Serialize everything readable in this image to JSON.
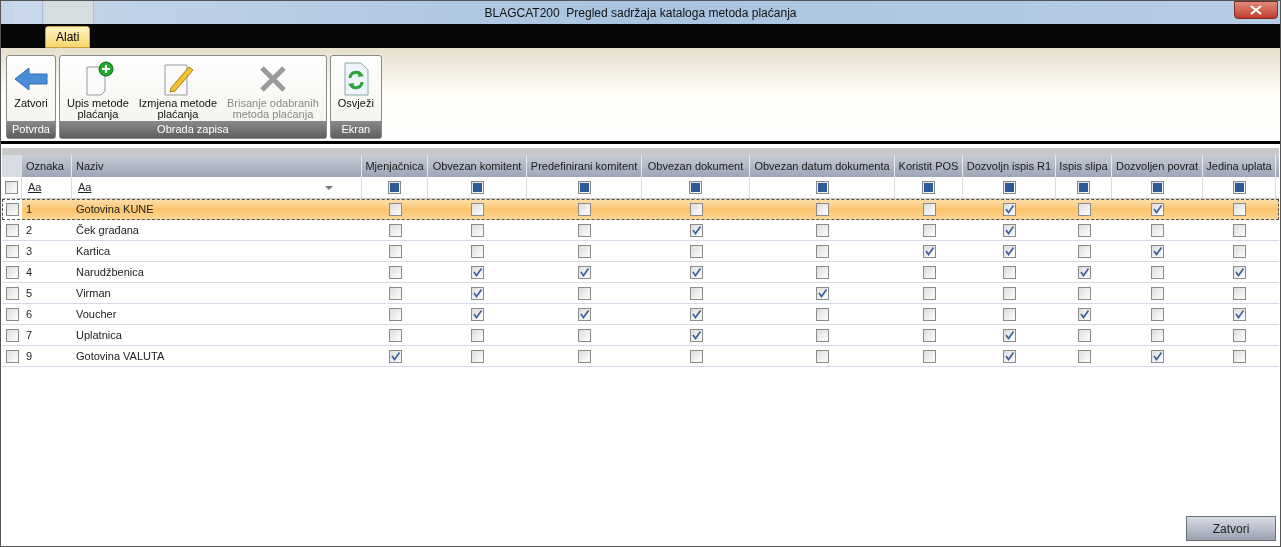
{
  "window": {
    "title": "BLAGCAT200  Pregled sadržaja kataloga metoda plaćanja"
  },
  "tabs": [
    {
      "label": "Alati",
      "selected": true
    }
  ],
  "ribbon": {
    "groups": [
      {
        "label": "Potvrda",
        "buttons": [
          {
            "kind": "back",
            "label": "Zatvori",
            "disabled": false
          }
        ]
      },
      {
        "label": "Obrada zapisa",
        "buttons": [
          {
            "kind": "add",
            "label": "Upis metode\nplaćanja",
            "disabled": false
          },
          {
            "kind": "edit",
            "label": "Izmjena metode\nplaćanja",
            "disabled": false
          },
          {
            "kind": "delete",
            "label": "Brisanje odabranih\nmetoda plaćanja",
            "disabled": true
          }
        ]
      },
      {
        "label": "Ekran",
        "buttons": [
          {
            "kind": "refresh",
            "label": "Osvježi",
            "disabled": false
          }
        ]
      }
    ]
  },
  "table": {
    "columns": [
      {
        "label": "Oznaka",
        "filter": "Aa"
      },
      {
        "label": "Naziv",
        "filter": "Aa"
      },
      {
        "label": "Mjenjačnica",
        "filter_indeterminate": true
      },
      {
        "label": "Obvezan komitent",
        "filter_indeterminate": true
      },
      {
        "label": "Predefinirani komitent",
        "filter_indeterminate": true
      },
      {
        "label": "Obvezan dokument",
        "filter_indeterminate": true
      },
      {
        "label": "Obvezan datum dokumenta",
        "filter_indeterminate": true
      },
      {
        "label": "Koristit POS",
        "filter_indeterminate": true
      },
      {
        "label": "Dozvoljn ispis R1",
        "filter_indeterminate": true
      },
      {
        "label": "Ispis slipa",
        "filter_indeterminate": true
      },
      {
        "label": "Dozvoljen povrat",
        "filter_indeterminate": true
      },
      {
        "label": "Jedina uplata",
        "filter_indeterminate": true
      }
    ],
    "select_all_checked": false,
    "rows": [
      {
        "oznaka": "1",
        "naziv": "Gotovina KUNE",
        "selected": true,
        "checked": false,
        "flags": [
          false,
          false,
          false,
          false,
          false,
          false,
          true,
          false,
          true,
          false
        ]
      },
      {
        "oznaka": "2",
        "naziv": "Ček građana",
        "selected": false,
        "checked": false,
        "flags": [
          false,
          false,
          false,
          true,
          false,
          false,
          true,
          false,
          false,
          false
        ]
      },
      {
        "oznaka": "3",
        "naziv": "Kartica",
        "selected": false,
        "checked": false,
        "flags": [
          false,
          false,
          false,
          false,
          false,
          true,
          true,
          false,
          true,
          false
        ]
      },
      {
        "oznaka": "4",
        "naziv": "Narudžbenica",
        "selected": false,
        "checked": false,
        "flags": [
          false,
          true,
          true,
          true,
          false,
          false,
          false,
          true,
          false,
          true
        ]
      },
      {
        "oznaka": "5",
        "naziv": "Virman",
        "selected": false,
        "checked": false,
        "flags": [
          false,
          true,
          false,
          false,
          true,
          false,
          false,
          false,
          false,
          false
        ]
      },
      {
        "oznaka": "6",
        "naziv": "Voucher",
        "selected": false,
        "checked": false,
        "flags": [
          false,
          true,
          true,
          true,
          false,
          false,
          false,
          true,
          false,
          true
        ]
      },
      {
        "oznaka": "7",
        "naziv": "Uplatnica",
        "selected": false,
        "checked": false,
        "flags": [
          false,
          false,
          false,
          true,
          false,
          false,
          true,
          false,
          false,
          false
        ]
      },
      {
        "oznaka": "9",
        "naziv": "Gotovina VALUTA",
        "selected": false,
        "checked": false,
        "flags": [
          true,
          false,
          false,
          false,
          false,
          false,
          true,
          false,
          true,
          false
        ]
      }
    ]
  },
  "footer_button": "Zatvori"
}
